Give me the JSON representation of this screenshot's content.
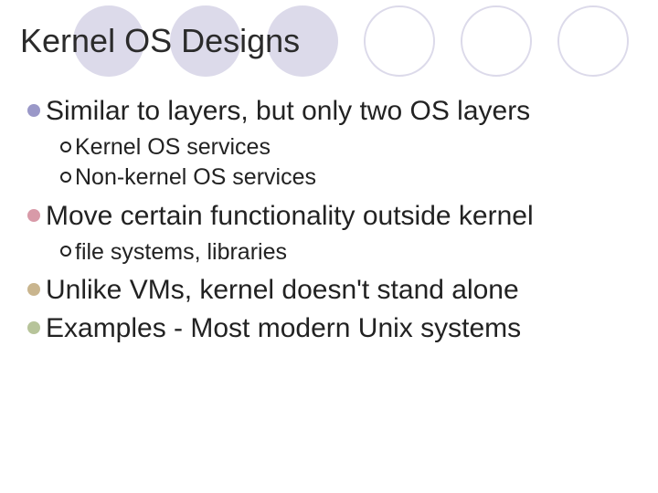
{
  "title": "Kernel OS Designs",
  "items": [
    {
      "text": "Similar to layers, but only two OS layers"
    },
    {
      "text": "Kernel OS services"
    },
    {
      "text": "Non-kernel OS services"
    },
    {
      "text": "Move certain functionality outside kernel"
    },
    {
      "text": "file systems, libraries"
    },
    {
      "text": "Unlike VMs, kernel doesn't stand alone"
    },
    {
      "text": "Examples - Most modern Unix systems"
    }
  ]
}
